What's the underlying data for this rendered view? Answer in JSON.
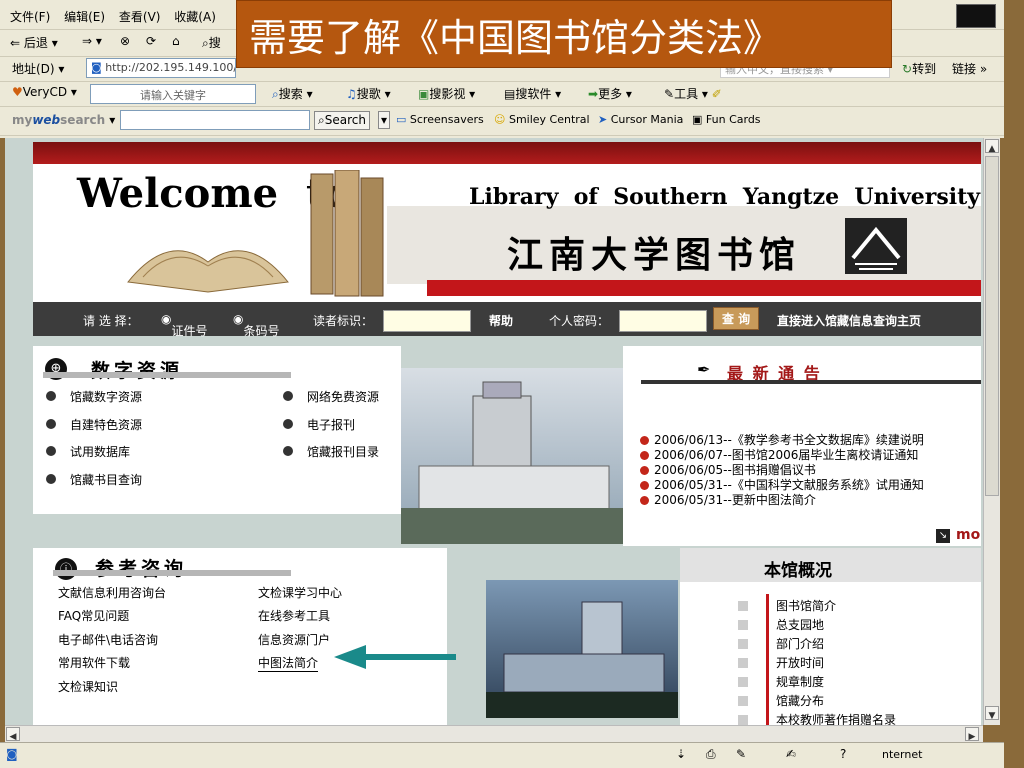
{
  "slide": {
    "title": "需要了解《中国图书馆分类法》"
  },
  "browser": {
    "menu": [
      "文件(F)",
      "编辑(E)",
      "查看(V)",
      "收藏(A)"
    ],
    "nav": {
      "back": "后退",
      "search_partial": "搜"
    },
    "address": {
      "label": "地址(D)",
      "url": "http://202.195.149.100/",
      "hint": "输入中文，直接搜索",
      "go": "转到",
      "links": "链接"
    },
    "verycd": {
      "brand": "VeryCD",
      "placeholder": "请输入关键字",
      "items": [
        "搜索",
        "搜歌",
        "搜影视",
        "搜软件",
        "更多",
        "工具"
      ]
    },
    "websearch": {
      "brand_my": "my",
      "brand_web": "web",
      "brand_search": "search",
      "search_button": "Search",
      "items": [
        "Screensavers",
        "Smiley Central",
        "Cursor Mania",
        "Fun Cards"
      ]
    },
    "status": {
      "zone": "nternet"
    }
  },
  "site": {
    "banner": {
      "welcome": "Welcome",
      "to": "to",
      "english_name": "Library  of  Southern  Yangtze  University",
      "chinese_name": "江南大学图书馆"
    },
    "login": {
      "select_label": "请 选 择：",
      "opt_id": "证件号",
      "opt_barcode": "条码号",
      "reader_label": "读者标识：",
      "help": "帮助",
      "password_label": "个人密码：",
      "query": "查 询",
      "direct": "直接进入馆藏信息查询主页"
    },
    "digital": {
      "title": "数字资源",
      "left": [
        "馆藏数字资源",
        "自建特色资源",
        "试用数据库",
        "馆藏书目查询"
      ],
      "right": [
        "网络免费资源",
        "电子报刊",
        "馆藏报刊目录"
      ]
    },
    "notices": {
      "title": "最 新 通 告",
      "items": [
        "2006/06/13--《教学参考书全文数据库》续建说明",
        "2006/06/07--图书馆2006届毕业生离校请证通知",
        "2006/06/05--图书捐赠倡议书",
        "2006/05/31--《中国科学文献服务系统》试用通知",
        "2006/05/31--更新中图法简介"
      ],
      "more": "more"
    },
    "reference": {
      "title": "参考咨询",
      "left": [
        "文献信息利用咨询台",
        "FAQ常见问题",
        "电子邮件\\电话咨询",
        "常用软件下载",
        "文检课知识"
      ],
      "right": [
        "文检课学习中心",
        "在线参考工具",
        "信息资源门户",
        "中图法简介"
      ]
    },
    "overview": {
      "title": "本馆概况",
      "items": [
        "图书馆简介",
        "总支园地",
        "部门介绍",
        "开放时间",
        "规章制度",
        "馆藏分布",
        "本校教师著作捐赠名录"
      ]
    }
  },
  "colors": {
    "slide_title_bg": "#b5570f",
    "header_red": "#a31818",
    "arrow_teal": "#1a8a8a"
  }
}
